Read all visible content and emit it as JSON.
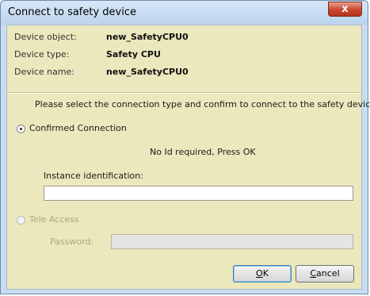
{
  "window": {
    "title": "Connect to safety device",
    "close_glyph": "x"
  },
  "device_info": [
    {
      "label": "Device object:",
      "value": "new_SafetyCPU0"
    },
    {
      "label": "Device type:",
      "value": "Safety CPU"
    },
    {
      "label": "Device name:",
      "value": "new_SafetyCPU0"
    }
  ],
  "instruction": "Please select the connection type and confirm to connect to the safety device.",
  "confirmed_connection": {
    "label": "Confirmed Connection",
    "selected": true,
    "message": "No Id required, Press OK",
    "instance_label": "Instance identification:",
    "instance_value": ""
  },
  "tele_access": {
    "label": "Tele Access",
    "selected": false,
    "enabled": false,
    "password_label": "Password:",
    "password_value": ""
  },
  "buttons": {
    "ok": {
      "mnemonic": "O",
      "rest": "K"
    },
    "cancel": {
      "mnemonic": "C",
      "rest": "ancel"
    }
  }
}
